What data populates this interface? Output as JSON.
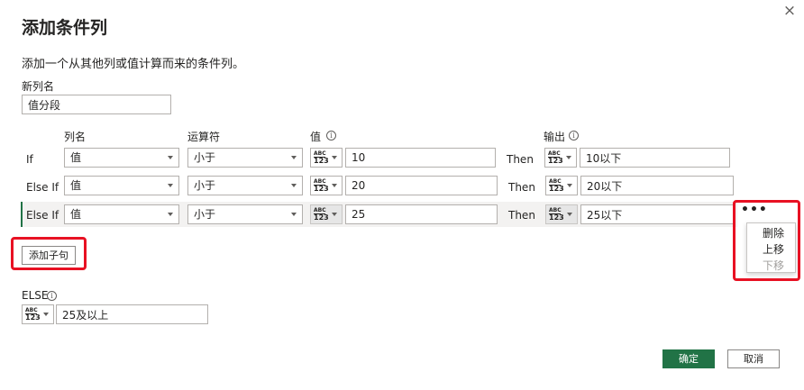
{
  "dialog": {
    "title": "添加条件列",
    "close_icon": "×",
    "description": "添加一个从其他列或值计算而来的条件列。",
    "new_column_label": "新列名",
    "new_column_value": "值分段"
  },
  "headers": {
    "column": "列名",
    "operator": "运算符",
    "value": "值",
    "output": "输出",
    "info_glyph": "i"
  },
  "type_button": {
    "line1": "ABC",
    "line2": "123"
  },
  "rows": [
    {
      "keyword": "If",
      "column": "值",
      "operator": "小于",
      "value": "10",
      "then": "Then",
      "output": "10以下"
    },
    {
      "keyword": "Else If",
      "column": "值",
      "operator": "小于",
      "value": "20",
      "then": "Then",
      "output": "20以下"
    },
    {
      "keyword": "Else If",
      "column": "值",
      "operator": "小于",
      "value": "25",
      "then": "Then",
      "output": "25以下"
    }
  ],
  "more_button": "•••",
  "context_menu": {
    "delete": "删除",
    "move_up": "上移",
    "move_down": "下移"
  },
  "add_clause_label": "添加子句",
  "else_section": {
    "label": "ELSE",
    "value": "25及以上"
  },
  "footer": {
    "ok": "确定",
    "cancel": "取消"
  },
  "colors": {
    "primary": "#217346",
    "highlight": "#e81123",
    "selected_row": "#f3f2f1"
  },
  "icons": [
    "close-icon",
    "info-icon",
    "chevron-down-icon",
    "type-abc123-icon",
    "more-options-icon"
  ]
}
